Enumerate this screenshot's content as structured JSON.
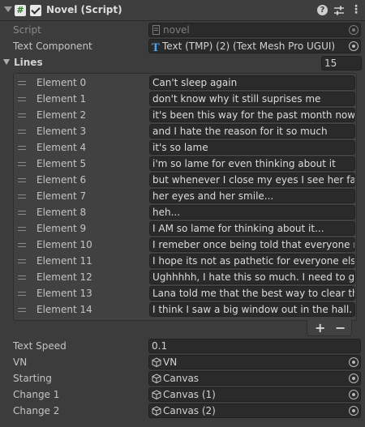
{
  "component": {
    "title": "Novel (Script)",
    "script_icon_glyph": "#"
  },
  "script": {
    "label": "Script",
    "value": "novel"
  },
  "text_component": {
    "label": "Text Component",
    "value": "Text (TMP) (2) (Text Mesh Pro UGUI)"
  },
  "lines": {
    "label": "Lines",
    "size": "15",
    "items": [
      {
        "label": "Element 0",
        "value": "Can't sleep again"
      },
      {
        "label": "Element 1",
        "value": "don't know why it still suprises me"
      },
      {
        "label": "Element 2",
        "value": "it's been this way for the past month now"
      },
      {
        "label": "Element 3",
        "value": "and I hate the reason for it so much"
      },
      {
        "label": "Element 4",
        "value": "it's so lame"
      },
      {
        "label": "Element 5",
        "value": "i'm so lame for even thinking about it"
      },
      {
        "label": "Element 6",
        "value": "but whenever I close my eyes I see her face"
      },
      {
        "label": "Element 7",
        "value": "her eyes and her smile..."
      },
      {
        "label": "Element 8",
        "value": "heh..."
      },
      {
        "label": "Element 9",
        "value": "I AM so lame for thinking about it..."
      },
      {
        "label": "Element 10",
        "value": "I remeber once being told that everyone reacts"
      },
      {
        "label": "Element 11",
        "value": "I hope its not as pathetic for everyone else..."
      },
      {
        "label": "Element 12",
        "value": "Ughhhhh, I hate this so much. I need to get out"
      },
      {
        "label": "Element 13",
        "value": "Lana told me that the best way to clear the mind"
      },
      {
        "label": "Element 14",
        "value": "I think I saw a big window out in the hall."
      }
    ],
    "add_label": "+",
    "remove_label": "−"
  },
  "text_speed": {
    "label": "Text Speed",
    "value": "0.1"
  },
  "vn": {
    "label": "VN",
    "value": "VN"
  },
  "starting": {
    "label": "Starting",
    "value": "Canvas"
  },
  "change1": {
    "label": "Change 1",
    "value": "Canvas (1)"
  },
  "change2": {
    "label": "Change 2",
    "value": "Canvas (2)"
  },
  "icons": {
    "foldout": "caret-down-icon",
    "help": "help-icon",
    "presets": "sliders-icon",
    "menu": "kebab-menu-icon",
    "object_picker": "object-picker-icon",
    "gameobject": "cube-icon"
  }
}
